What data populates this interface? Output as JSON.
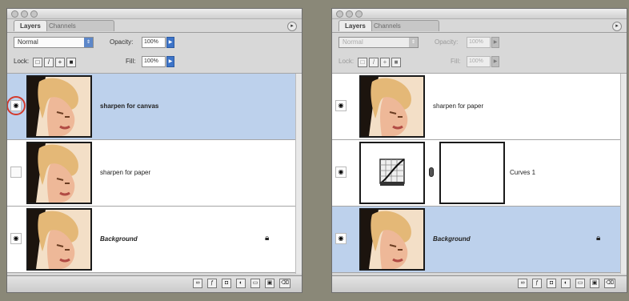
{
  "panels": [
    {
      "tabs": {
        "active": "Layers",
        "inactive": "Channels"
      },
      "options": {
        "blend_mode": "Normal",
        "opacity_label": "Opacity:",
        "opacity_value": "100%",
        "lock_label": "Lock:",
        "fill_label": "Fill:",
        "fill_value": "100%"
      },
      "layers": [
        {
          "name": "sharpen for canvas",
          "visible": true,
          "selected": true
        },
        {
          "name": "sharpen for paper",
          "visible": false,
          "selected": false
        },
        {
          "name": "Background",
          "visible": true,
          "selected": false,
          "locked": true
        }
      ]
    },
    {
      "tabs": {
        "active": "Layers",
        "inactive": "Channels"
      },
      "options": {
        "blend_mode": "Normal",
        "opacity_label": "Opacity:",
        "opacity_value": "100%",
        "lock_label": "Lock:",
        "fill_label": "Fill:",
        "fill_value": "100%"
      },
      "layers": [
        {
          "name": "sharpen for paper",
          "visible": true,
          "selected": false
        },
        {
          "name": "Curves 1",
          "visible": true,
          "selected": false,
          "adjustment": "curves-icon"
        },
        {
          "name": "Background",
          "visible": true,
          "selected": true,
          "locked": true
        }
      ]
    }
  ],
  "colors": {
    "selection": "#bdd1ec",
    "highlight_circle": "#d33a2c",
    "stepper_blue": "#3d74c8"
  }
}
